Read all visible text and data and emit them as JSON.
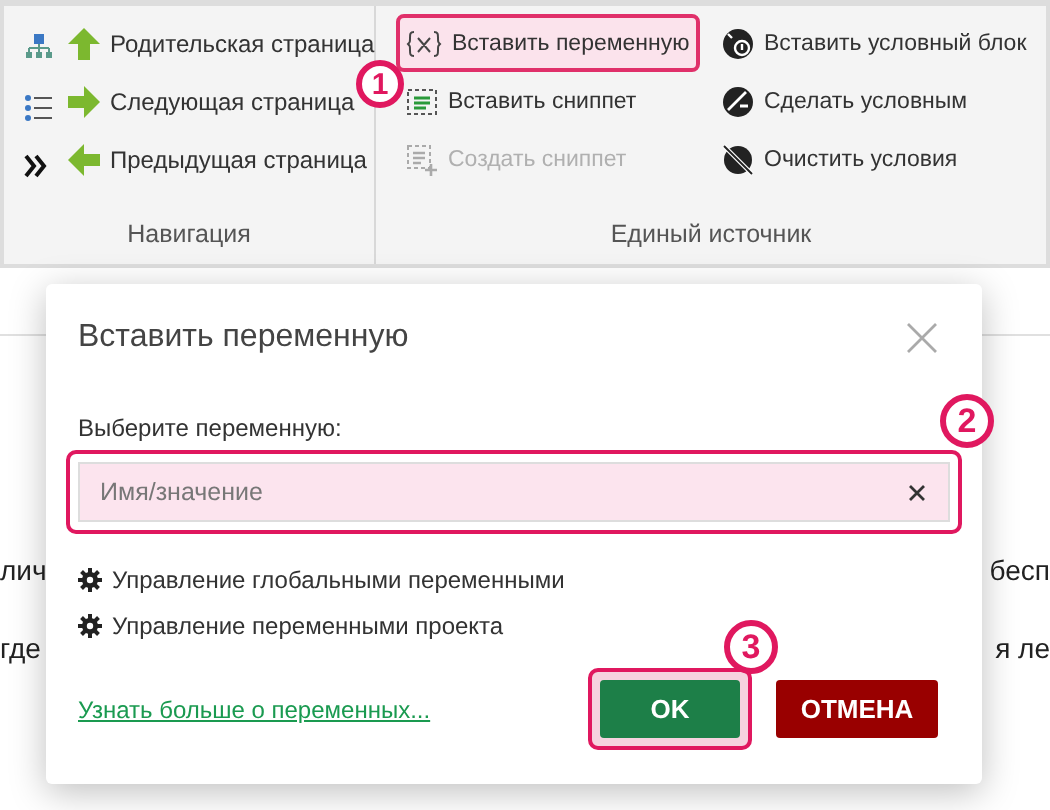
{
  "ribbon": {
    "groups": [
      {
        "label": "Навигация",
        "items": [
          {
            "label": "Родительская страница",
            "kind": "up",
            "disabled": false
          },
          {
            "label": "Следующая страница",
            "kind": "right",
            "disabled": false
          },
          {
            "label": "Предыдущая страница",
            "kind": "left",
            "disabled": false
          }
        ]
      },
      {
        "label": "Единый источник",
        "items": [
          {
            "label": "Вставить переменную",
            "kind": "variable",
            "disabled": false,
            "highlighted": true,
            "callout": "1"
          },
          {
            "label": "Вставить сниппет",
            "kind": "snippet",
            "disabled": false,
            "highlighted": false
          },
          {
            "label": "Создать сниппет",
            "kind": "new-snippet",
            "disabled": true,
            "highlighted": false
          },
          {
            "label": "Вставить условный блок",
            "kind": "cond-block",
            "disabled": false,
            "highlighted": false
          },
          {
            "label": "Сделать условным",
            "kind": "make-cond",
            "disabled": false,
            "highlighted": false
          },
          {
            "label": "Очистить условия",
            "kind": "clear-cond",
            "disabled": false,
            "highlighted": false
          }
        ]
      }
    ]
  },
  "background_text": [
    "лич",
    "бесп",
    "где",
    "я ле"
  ],
  "dialog": {
    "title": "Вставить переменную",
    "field": {
      "label": "Выберите переменную:",
      "placeholder": "Имя/значение",
      "highlighted": true,
      "callout": "2"
    },
    "links": [
      "Управление глобальными переменными",
      "Управление переменными проекта"
    ],
    "learn_more": "Узнать больше о переменных...",
    "buttons": [
      {
        "label": "OK",
        "kind": "primary",
        "highlighted": true,
        "callout": "3"
      },
      {
        "label": "ОТМЕНА",
        "kind": "cancel",
        "highlighted": false
      }
    ]
  }
}
